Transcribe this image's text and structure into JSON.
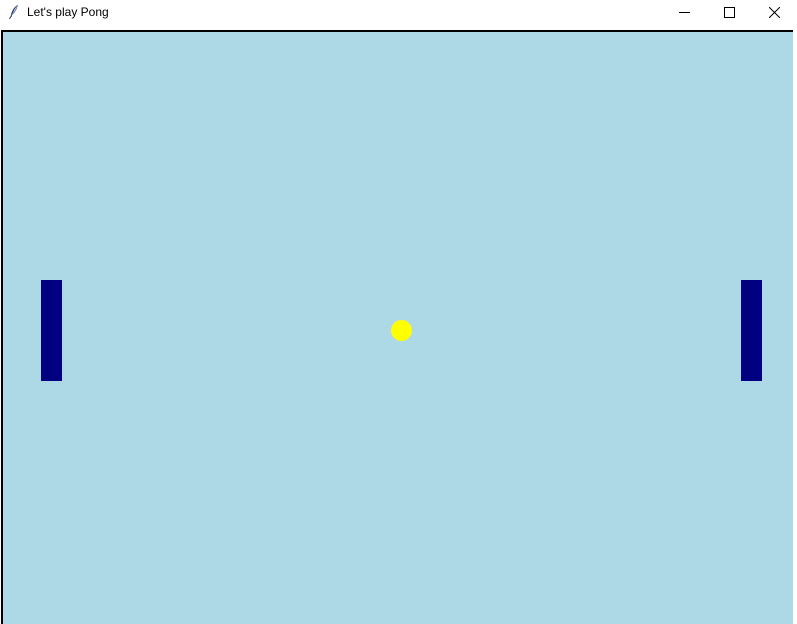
{
  "window": {
    "title": "Let's play Pong",
    "icons": {
      "app": "feather-icon",
      "minimize": "minimize-icon",
      "maximize": "maximize-icon",
      "close": "close-icon"
    }
  },
  "game": {
    "colors": {
      "background": "#add8e6",
      "paddle": "#000080",
      "ball": "#ffff00"
    }
  }
}
